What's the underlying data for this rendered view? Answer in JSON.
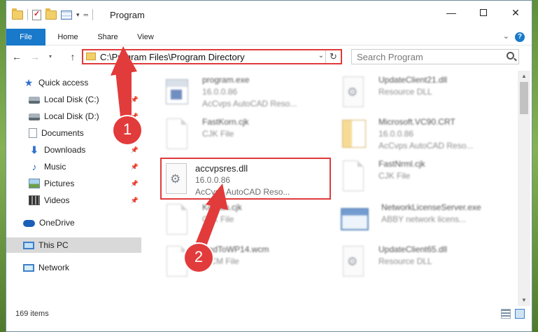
{
  "window": {
    "title": "Program"
  },
  "ribbon": {
    "tabs": [
      {
        "label": "File"
      },
      {
        "label": "Home"
      },
      {
        "label": "Share"
      },
      {
        "label": "View"
      }
    ],
    "help_label": "?"
  },
  "address": {
    "path": "C:\\Program Files\\Program Directory"
  },
  "search": {
    "placeholder": "Search Program"
  },
  "sidebar": {
    "items": [
      {
        "label": "Quick access",
        "icon": "star-icon"
      },
      {
        "label": "Local Disk (C:)",
        "icon": "drive-icon"
      },
      {
        "label": "Local Disk (D:)",
        "icon": "drive-icon"
      },
      {
        "label": "Documents",
        "icon": "documents-icon"
      },
      {
        "label": "Downloads",
        "icon": "downloads-icon"
      },
      {
        "label": "Music",
        "icon": "music-icon"
      },
      {
        "label": "Pictures",
        "icon": "pictures-icon"
      },
      {
        "label": "Videos",
        "icon": "videos-icon"
      },
      {
        "label": "OneDrive",
        "icon": "onedrive-icon"
      },
      {
        "label": "This PC",
        "icon": "this-pc-icon",
        "selected": true
      },
      {
        "label": "Network",
        "icon": "network-icon"
      }
    ]
  },
  "files": [
    {
      "name": "program.exe",
      "line2": "16.0.0.86",
      "line3": "AcCvps AutoCAD Reso...",
      "icon": "exe-file-icon"
    },
    {
      "name": "UpdateClient21.dll",
      "line2": "Resource DLL",
      "line3": "",
      "icon": "dll-file-icon"
    },
    {
      "name": "FastKorn.cjk",
      "line2": "CJK File",
      "line3": "",
      "icon": "blank-file-icon"
    },
    {
      "name": "Microsoft.VC90.CRT",
      "line2": "16.0.0.86",
      "line3": "AcCvps AutoCAD Reso...",
      "icon": "manifest-file-icon"
    },
    {
      "name": "accvpsres.dll",
      "line2": "16.0.0.86",
      "line3": "AcCvps AutoCAD Reso...",
      "icon": "dll-file-icon"
    },
    {
      "name": "FastNrml.cjk",
      "line2": "CJK File",
      "line3": "",
      "icon": "blank-file-icon"
    },
    {
      "name": "Korean.cjk",
      "line2": "CJK File",
      "line3": "",
      "icon": "blank-file-icon"
    },
    {
      "name": "NetworkLicenseServer.exe",
      "line2": "ABBY network licens...",
      "line3": "",
      "icon": "network-app-icon"
    },
    {
      "name": "CadToWP14.wcm",
      "line2": "WCM File",
      "line3": "",
      "icon": "blank-file-icon"
    },
    {
      "name": "UpdateClient65.dll",
      "line2": "Resource DLL",
      "line3": "",
      "icon": "dll-file-icon"
    }
  ],
  "status": {
    "item_count": "169 items"
  },
  "annotations": {
    "step1": "1",
    "step2": "2"
  },
  "colors": {
    "accent": "#1979ca",
    "highlight": "#e03a3a"
  }
}
